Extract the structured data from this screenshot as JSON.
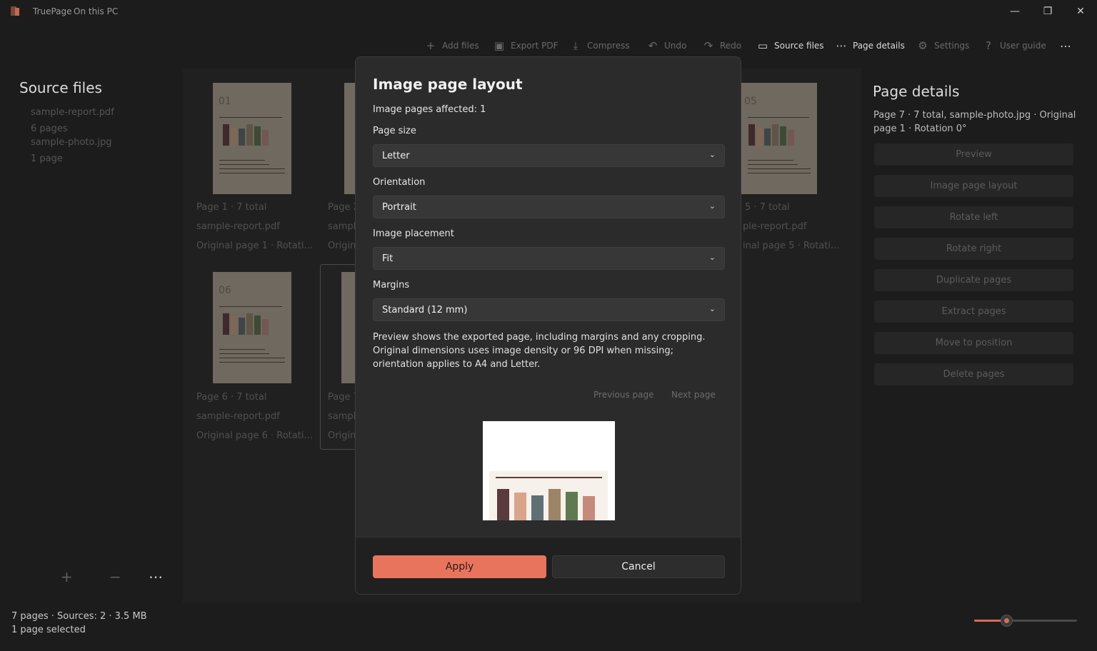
{
  "app": {
    "name": "TruePage",
    "location": "On this PC"
  },
  "window_controls": {
    "minimize": "—",
    "maximize": "❐",
    "close": "✕"
  },
  "toolbar": {
    "add_files": "Add files",
    "export_pdf": "Export PDF",
    "compress": "Compress",
    "undo": "Undo",
    "redo": "Redo",
    "source_files": "Source files",
    "page_details": "Page details",
    "settings": "Settings",
    "user_guide": "User guide",
    "more": "⋯"
  },
  "source_panel": {
    "title": "Source files",
    "files": [
      {
        "name": "sample-report.pdf",
        "pages": "6 pages"
      },
      {
        "name": "sample-photo.jpg",
        "pages": "1 page"
      }
    ],
    "add": "+",
    "remove": "−",
    "more": "⋯"
  },
  "grid": {
    "cards": [
      {
        "num": "01",
        "line1": "Page 1 · 7 total",
        "line2": "sample-report.pdf",
        "line3": "Original page 1 · Rotati..."
      },
      {
        "num": "",
        "line1": "Page 2",
        "line2": "sampl",
        "line3": "Origin"
      },
      {
        "num": "05",
        "line1": "5 · 7 total",
        "line2": "ple-report.pdf",
        "line3": "inal page 5 · Rotati..."
      },
      {
        "num": "06",
        "line1": "Page 6 · 7 total",
        "line2": "sample-report.pdf",
        "line3": "Original page 6 · Rotati..."
      },
      {
        "num": "",
        "line1": "Page 7",
        "line2": "sampl",
        "line3": "Origin"
      }
    ]
  },
  "details_panel": {
    "title": "Page details",
    "subtitle": "Page 7 · 7 total, sample-photo.jpg · Original page 1 · Rotation 0°",
    "actions": [
      "Preview",
      "Image page layout",
      "Rotate left",
      "Rotate right",
      "Duplicate pages",
      "Extract pages",
      "Move to position",
      "Delete pages"
    ]
  },
  "status": {
    "summary": "7 pages · Sources: 2 · 3.5 MB",
    "selection": "1 page selected",
    "zoom_fraction": 0.3
  },
  "dialog": {
    "title": "Image page layout",
    "affected": "Image pages affected: 1",
    "page_size": {
      "label": "Page size",
      "value": "Letter"
    },
    "orientation": {
      "label": "Orientation",
      "value": "Portrait"
    },
    "placement": {
      "label": "Image placement",
      "value": "Fit"
    },
    "margins": {
      "label": "Margins",
      "value": "Standard (12 mm)"
    },
    "note": "Preview shows the exported page, including margins and any cropping. Original dimensions uses image density or 96 DPI when missing; orientation applies to A4 and Letter.",
    "prev_page": "Previous page",
    "next_page": "Next page",
    "apply": "Apply",
    "cancel": "Cancel"
  },
  "colors": {
    "accent": "#e9745e",
    "bar_colors": [
      "#5a3a3d",
      "#d9a48c",
      "#5f6f74",
      "#9c8467",
      "#5f7a50",
      "#c48b7c"
    ]
  }
}
